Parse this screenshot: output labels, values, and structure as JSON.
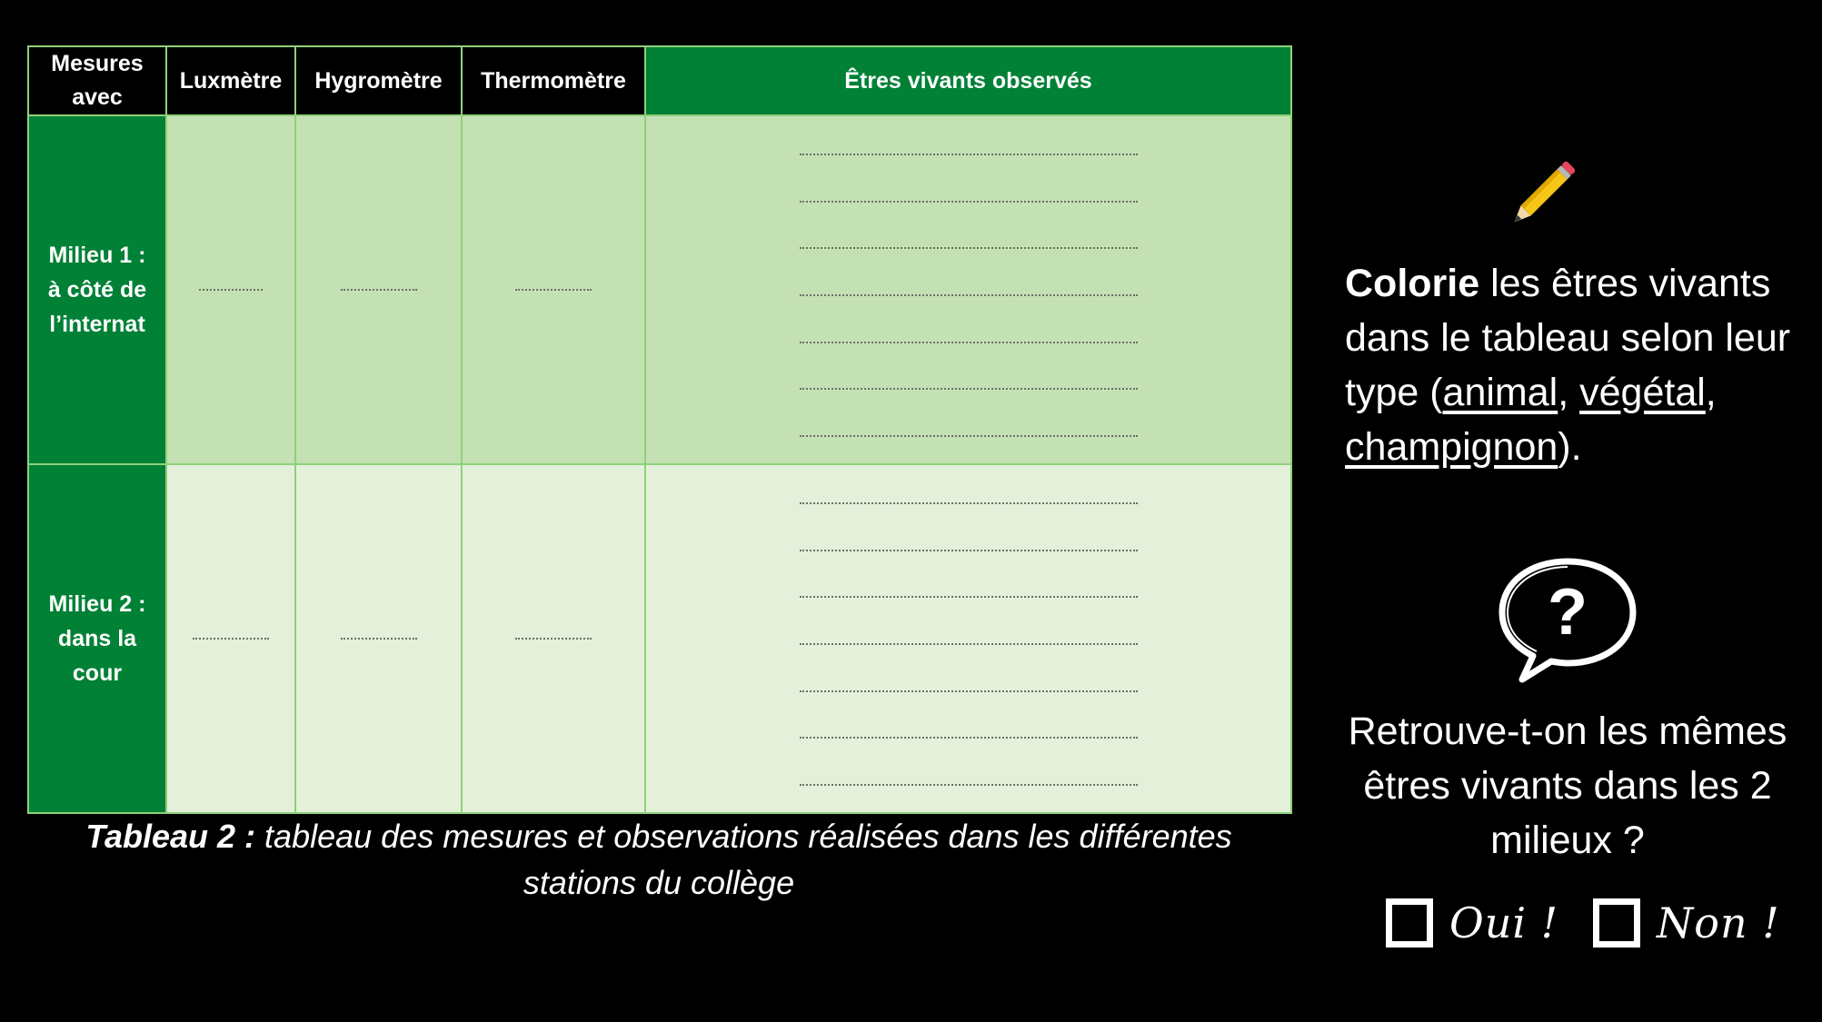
{
  "table": {
    "headers": [
      "Mesures avec",
      "Luxmètre",
      "Hygromètre",
      "Thermomètre",
      "Êtres vivants observés"
    ],
    "rows": [
      {
        "label_lines": [
          "Milieu 1 :",
          "à côté de",
          "l’internat"
        ]
      },
      {
        "label_lines": [
          "Milieu 2 :",
          "dans la",
          "cour"
        ]
      }
    ]
  },
  "caption": {
    "bold": "Tableau 2 :",
    "rest": " tableau des mesures et observations réalisées dans les différentes stations du collège"
  },
  "instruction": {
    "bold": "Colorie",
    "text": " les êtres vivants dans le tableau selon leur type (",
    "opt1": "animal",
    "sep1": ", ",
    "opt2": "végétal",
    "sep2": ", ",
    "opt3": "champignon",
    "end": ")."
  },
  "question": "Retrouve-t-on les mêmes êtres vivants dans les 2 milieux ?",
  "choices": {
    "yes": "Oui !",
    "no": "Non !"
  },
  "icons": {
    "pencil": "pencil-icon",
    "bubble": "question-bubble-icon"
  },
  "colors": {
    "header_green": "#008136",
    "row1_green": "#c4e1b4",
    "row2_green": "#e4f0da",
    "border": "#8fd07a"
  }
}
